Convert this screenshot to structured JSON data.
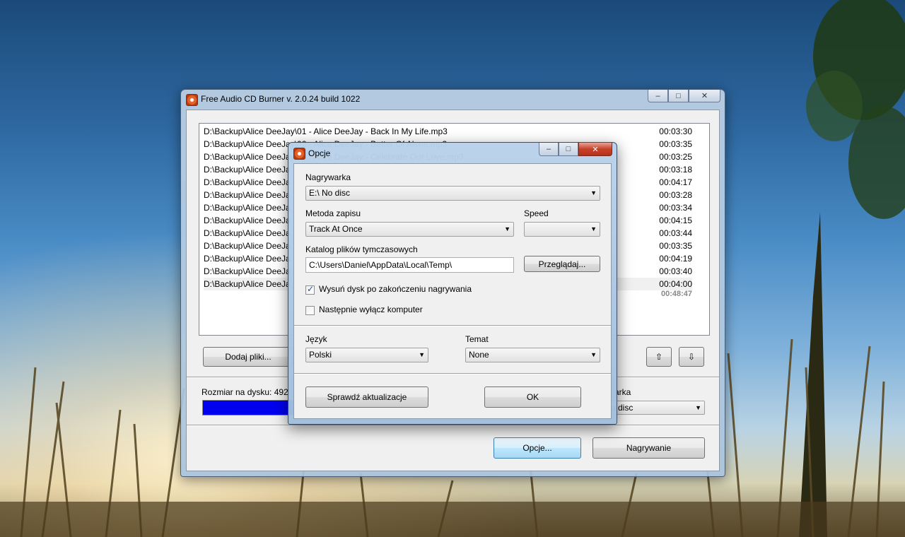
{
  "main_window": {
    "title": "Free Audio CD Burner  v. 2.0.24 build 1022",
    "window_buttons": {
      "minimize": "–",
      "maximize": "□",
      "close": "✕"
    },
    "tracks": [
      {
        "path": "D:\\Backup\\Alice DeeJay\\01 - Alice DeeJay - Back In My Life.mp3",
        "duration": "00:03:30"
      },
      {
        "path": "D:\\Backup\\Alice DeeJay\\02 - Alice DeeJay - Better Of Alone.mp3",
        "duration": "00:03:35"
      },
      {
        "path": "D:\\Backup\\Alice DeeJay\\03 - Alice DeeJay - Celebrate Our Love.mp3",
        "duration": "00:03:25"
      },
      {
        "path": "D:\\Backup\\Alice DeeJa",
        "duration": "00:03:18"
      },
      {
        "path": "D:\\Backup\\Alice DeeJa",
        "duration": "00:04:17"
      },
      {
        "path": "D:\\Backup\\Alice DeeJa",
        "duration": "00:03:28"
      },
      {
        "path": "D:\\Backup\\Alice DeeJa",
        "duration": "00:03:34"
      },
      {
        "path": "D:\\Backup\\Alice DeeJa",
        "duration": "00:04:15"
      },
      {
        "path": "D:\\Backup\\Alice DeeJa",
        "duration": "00:03:44"
      },
      {
        "path": "D:\\Backup\\Alice DeeJa",
        "duration": "00:03:35"
      },
      {
        "path": "D:\\Backup\\Alice DeeJa",
        "duration": "00:04:19"
      },
      {
        "path": "D:\\Backup\\Alice DeeJa",
        "duration": "00:03:40"
      },
      {
        "path": "D:\\Backup\\Alice DeeJa",
        "duration": "00:04:00"
      }
    ],
    "total_duration": "00:48:47",
    "add_files_label": "Dodaj pliki...",
    "move_up_icon": "⇧",
    "move_down_icon": "⇩",
    "disk_size_label": "Rozmiar na dysku:  492",
    "recorder_label_partial": "arka",
    "recorder_value_partial": "o disc",
    "options_label": "Opcje...",
    "burn_label": "Nagrywanie"
  },
  "options_dialog": {
    "title": "Opcje",
    "recorder_label": "Nagrywarka",
    "recorder_value": "E:\\ No disc",
    "write_method_label": "Metoda zapisu",
    "write_method_value": "Track At Once",
    "speed_label": "Speed",
    "speed_value": "",
    "temp_dir_label": "Katalog plików tymczasowych",
    "temp_dir_value": "C:\\Users\\Daniel\\AppData\\Local\\Temp\\",
    "browse_label": "Przeglądaj...",
    "eject_label": "Wysuń dysk po zakończeniu nagrywania",
    "eject_checked": true,
    "shutdown_label": "Następnie wyłącz komputer",
    "shutdown_checked": false,
    "language_label": "Język",
    "language_value": "Polski",
    "theme_label": "Temat",
    "theme_value": "None",
    "check_updates_label": "Sprawdź aktualizacje",
    "ok_label": "OK"
  }
}
